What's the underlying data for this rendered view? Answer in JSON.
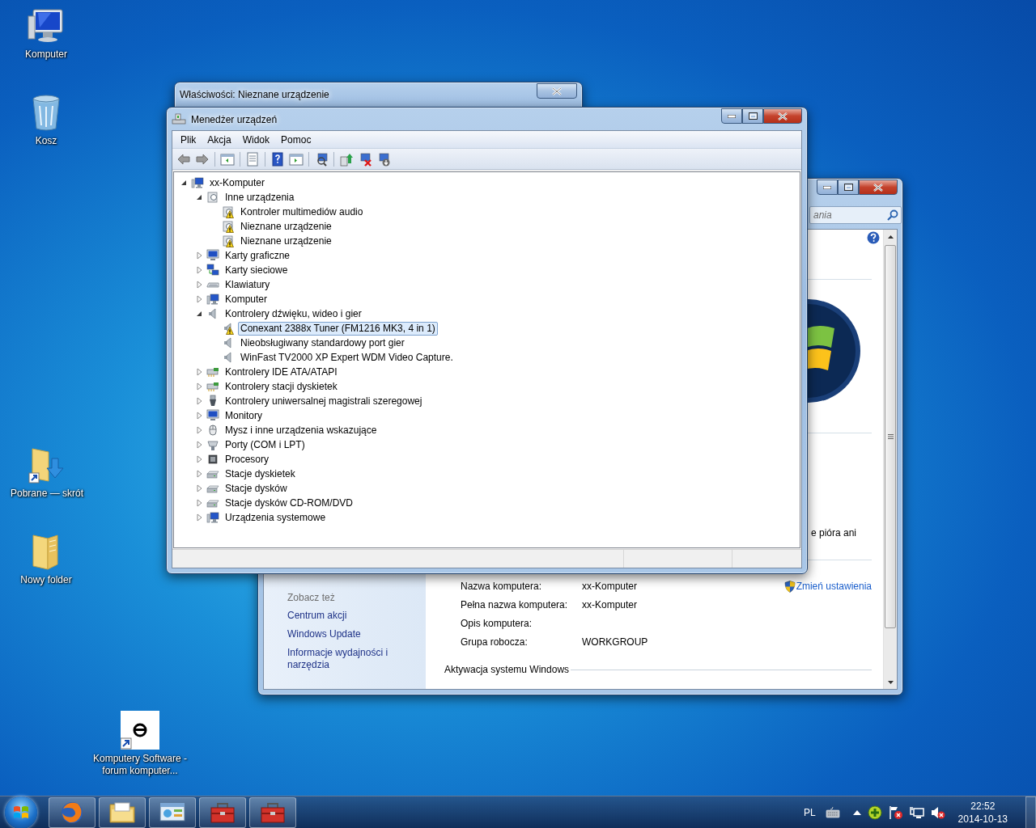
{
  "desktop_icons": [
    {
      "label": "Komputer",
      "kind": "computer"
    },
    {
      "label": "Kosz",
      "kind": "recycle-bin"
    },
    {
      "label": "Pobrane — skrót",
      "kind": "download-shortcut"
    },
    {
      "label": "Nowy folder",
      "kind": "folder"
    },
    {
      "label": "Komputery Software - forum komputer...",
      "kind": "web-shortcut"
    }
  ],
  "properties_window": {
    "title": "Właściwości: Nieznane urządzenie"
  },
  "system_window": {
    "search": {
      "placeholder": "ania"
    },
    "partial_text": "e pióra ani",
    "see_also": {
      "heading": "Zobacz też",
      "links": [
        "Centrum akcji",
        "Windows Update",
        "Informacje wydajności i narzędzia"
      ]
    },
    "computer_info": [
      {
        "label": "Nazwa komputera:",
        "value": "xx-Komputer"
      },
      {
        "label": "Pełna nazwa komputera:",
        "value": "xx-Komputer"
      },
      {
        "label": "Opis komputera:"
      },
      {
        "label": "Grupa robocza:",
        "value": "WORKGROUP"
      }
    ],
    "change_link": "Zmień ustawienia",
    "activation_heading": "Aktywacja systemu Windows"
  },
  "device_manager": {
    "title": "Menedżer urządzeń",
    "menu": [
      "Plik",
      "Akcja",
      "Widok",
      "Pomoc"
    ],
    "tree": [
      {
        "label": "xx-Komputer",
        "kind": "computer",
        "expanded": true,
        "selected": false,
        "children": [
          {
            "label": "Inne urządzenia",
            "kind": "unknown",
            "expanded": true,
            "selected": false,
            "children": [
              {
                "label": "Kontroler multimediów audio",
                "kind": "unknown",
                "warning": true,
                "selected": false
              },
              {
                "label": "Nieznane urządzenie",
                "kind": "unknown",
                "warning": true,
                "selected": false
              },
              {
                "label": "Nieznane urządzenie",
                "kind": "unknown",
                "warning": true,
                "selected": false
              }
            ]
          },
          {
            "label": "Karty graficzne",
            "kind": "display",
            "expanded": false,
            "selected": false
          },
          {
            "label": "Karty sieciowe",
            "kind": "network",
            "expanded": false,
            "selected": false
          },
          {
            "label": "Klawiatury",
            "kind": "keyboard",
            "expanded": false,
            "selected": false
          },
          {
            "label": "Komputer",
            "kind": "computer",
            "expanded": false,
            "selected": false
          },
          {
            "label": "Kontrolery dźwięku, wideo i gier",
            "kind": "sound",
            "expanded": true,
            "selected": false,
            "children": [
              {
                "label": "Conexant 2388x Tuner (FM1216 MK3, 4 in 1)",
                "kind": "sound",
                "warning": true,
                "selected": true
              },
              {
                "label": "Nieobsługiwany standardowy port gier",
                "kind": "sound",
                "warning": false,
                "selected": false
              },
              {
                "label": "WinFast TV2000 XP Expert WDM Video Capture.",
                "kind": "sound",
                "warning": false,
                "selected": false
              }
            ]
          },
          {
            "label": "Kontrolery IDE ATA/ATAPI",
            "kind": "controller",
            "expanded": false,
            "selected": false
          },
          {
            "label": "Kontrolery stacji dyskietek",
            "kind": "controller",
            "expanded": false,
            "selected": false
          },
          {
            "label": "Kontrolery uniwersalnej magistrali szeregowej",
            "kind": "usb",
            "expanded": false,
            "selected": false
          },
          {
            "label": "Monitory",
            "kind": "display",
            "expanded": false,
            "selected": false
          },
          {
            "label": "Mysz i inne urządzenia wskazujące",
            "kind": "mouse",
            "expanded": false,
            "selected": false
          },
          {
            "label": "Porty (COM i LPT)",
            "kind": "port",
            "expanded": false,
            "selected": false
          },
          {
            "label": "Procesory",
            "kind": "cpu",
            "expanded": false,
            "selected": false
          },
          {
            "label": "Stacje dyskietek",
            "kind": "drive",
            "expanded": false,
            "selected": false
          },
          {
            "label": "Stacje dysków",
            "kind": "drive",
            "expanded": false,
            "selected": false
          },
          {
            "label": "Stacje dysków CD-ROM/DVD",
            "kind": "drive",
            "expanded": false,
            "selected": false
          },
          {
            "label": "Urządzenia systemowe",
            "kind": "computer",
            "expanded": false,
            "selected": false
          }
        ]
      }
    ]
  },
  "taskbar": {
    "buttons": [
      {
        "kind": "browser"
      },
      {
        "kind": "explorer"
      },
      {
        "kind": "control-panel"
      },
      {
        "kind": "toolbox"
      },
      {
        "kind": "toolbox"
      }
    ],
    "language": "PL",
    "time": "22:52",
    "date": "2014-10-13"
  }
}
